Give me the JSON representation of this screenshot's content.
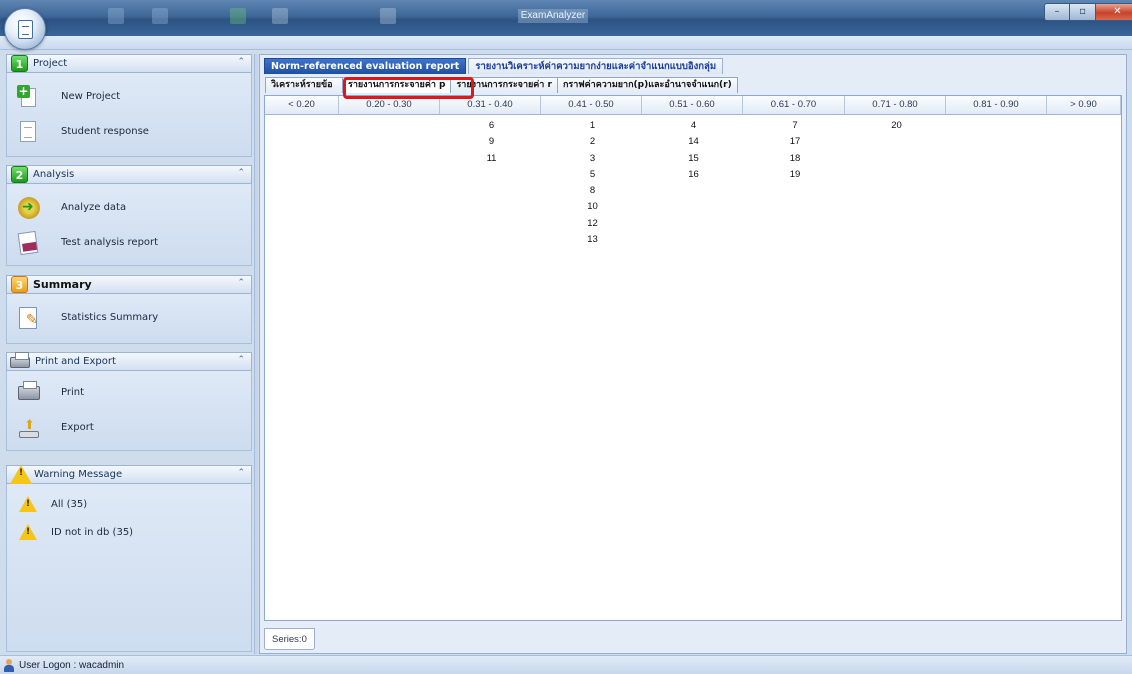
{
  "window": {
    "title": "ExamAnalyzer",
    "controls": [
      "minimize",
      "maximize",
      "close"
    ]
  },
  "nav": {
    "groups": [
      {
        "number": "1",
        "title": "Project",
        "items": [
          {
            "label": "New Project",
            "icon": "new-project-icon"
          },
          {
            "label": "Student response",
            "icon": "document-icon"
          }
        ]
      },
      {
        "number": "2",
        "title": "Analysis",
        "items": [
          {
            "label": "Analyze data",
            "icon": "analyze-gear-icon"
          },
          {
            "label": "Test analysis report",
            "icon": "report-icon"
          }
        ]
      },
      {
        "number": "3",
        "title": "Summary",
        "items": [
          {
            "label": "Statistics Summary",
            "icon": "statistics-icon"
          }
        ]
      },
      {
        "title": "Print and Export",
        "items": [
          {
            "label": "Print",
            "icon": "printer-icon"
          },
          {
            "label": "Export",
            "icon": "export-icon"
          }
        ]
      },
      {
        "title": "Warning Message",
        "items": [
          {
            "label": "All (35)",
            "icon": "warning-icon"
          },
          {
            "label": "ID not in db (35)",
            "icon": "warning-icon"
          }
        ]
      }
    ]
  },
  "main": {
    "top_tabs": [
      {
        "label": "Norm-referenced evaluation report",
        "active": true
      },
      {
        "label": "รายงานวิเคราะห์ค่าความยากง่ายและค่าจำแนกแบบอิงกลุ่ม",
        "active": false
      }
    ],
    "sub_tabs": [
      {
        "label": "วิเคราะห์รายข้อ",
        "active": false
      },
      {
        "label": "รายงานการกระจายค่า p",
        "active": true
      },
      {
        "label": "รายงานการกระจายค่า r",
        "active": false
      },
      {
        "label": "กราฟค่าความยาก(p)และอำนาจจำแนก(r)",
        "active": false
      }
    ],
    "grid": {
      "columns": [
        "< 0.20",
        "0.20 - 0.30",
        "0.31 - 0.40",
        "0.41 - 0.50",
        "0.51 - 0.60",
        "0.61 - 0.70",
        "0.71 - 0.80",
        "0.81 - 0.90",
        "> 0.90"
      ],
      "values": [
        [],
        [],
        [
          "6",
          "9",
          "11"
        ],
        [
          "1",
          "2",
          "3",
          "5",
          "8",
          "10",
          "12",
          "13"
        ],
        [
          "4",
          "14",
          "15",
          "16"
        ],
        [
          "7",
          "17",
          "18",
          "19"
        ],
        [
          "20"
        ],
        [],
        []
      ]
    },
    "footer_tab": "Series:0"
  },
  "status": {
    "user_logon": "User Logon : wacadmin"
  },
  "colors": {
    "accent": "#1f4fa3",
    "highlight": "#e0161b",
    "group_badge_green": "#1c9a1a",
    "group_badge_orange": "#f19b12",
    "warning": "#f5c518"
  }
}
